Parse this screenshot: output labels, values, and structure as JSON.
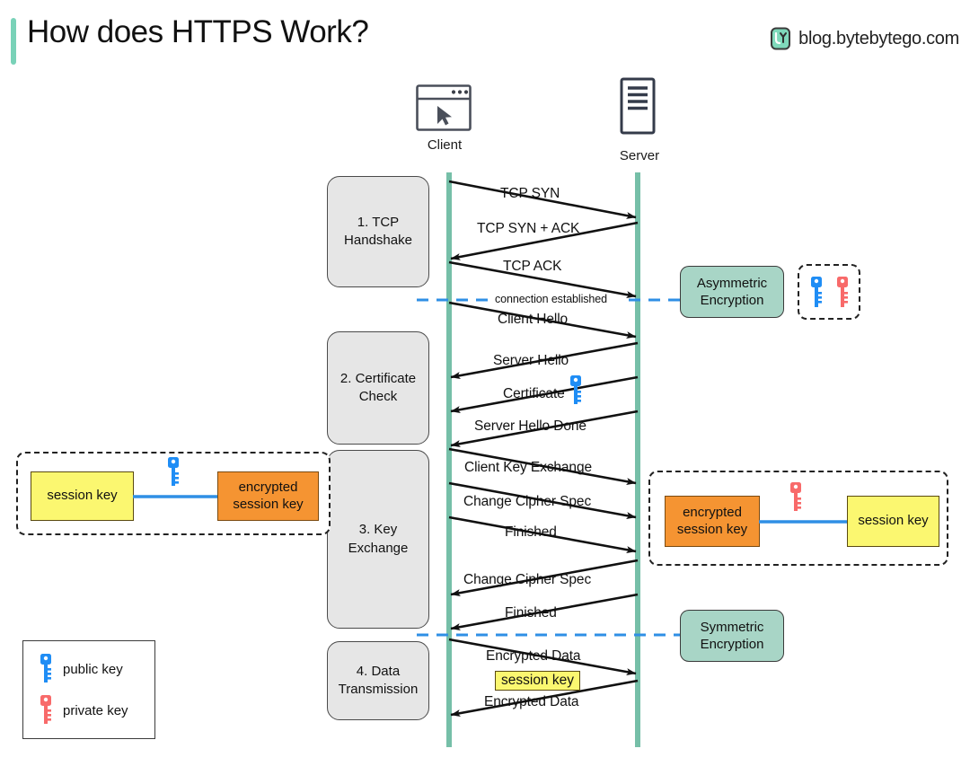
{
  "header": {
    "title": "How does HTTPS Work?",
    "brand_text": "blog.bytebytego.com",
    "accent_color": "#79d2b8",
    "logo_icon": "bytebytego-logo-icon"
  },
  "actors": {
    "client": {
      "label": "Client",
      "icon": "browser-window-icon"
    },
    "server": {
      "label": "Server",
      "icon": "server-rack-icon"
    },
    "lifeline_color": "#76bfa8"
  },
  "stages": [
    {
      "label": "1. TCP\nHandshake",
      "line1": "1. TCP",
      "line2": "Handshake"
    },
    {
      "label": "2. Certificate\nCheck",
      "line1": "2. Certificate",
      "line2": "Check"
    },
    {
      "label": "3. Key\nExchange",
      "line1": "3. Key",
      "line2": "Exchange"
    },
    {
      "label": "4. Data\nTransmission",
      "line1": "4. Data",
      "line2": "Transmission"
    }
  ],
  "messages": [
    {
      "label": "TCP SYN",
      "direction": "client-to-server"
    },
    {
      "label": "TCP SYN + ACK",
      "direction": "server-to-client"
    },
    {
      "label": "TCP ACK",
      "direction": "client-to-server"
    },
    {
      "label": "Client Hello",
      "direction": "client-to-server"
    },
    {
      "label": "Server Hello",
      "direction": "server-to-client"
    },
    {
      "label": "Certificate",
      "direction": "server-to-client",
      "icon": "public-key-icon"
    },
    {
      "label": "Server Hello Done",
      "direction": "server-to-client"
    },
    {
      "label": "Client Key Exchange",
      "direction": "client-to-server"
    },
    {
      "label": "Change Cipher Spec",
      "direction": "client-to-server"
    },
    {
      "label": "Finished",
      "direction": "client-to-server"
    },
    {
      "label": "Change Cipher Spec",
      "direction": "server-to-client"
    },
    {
      "label": "Finished",
      "direction": "server-to-client"
    },
    {
      "label": "Encrypted  Data",
      "direction": "client-to-server"
    },
    {
      "label": "Encrypted Data",
      "direction": "server-to-client"
    }
  ],
  "separators": [
    {
      "label": "connection established",
      "color": "#2f8fe5"
    },
    {
      "label": "",
      "color": "#2f8fe5"
    },
    {
      "label": "",
      "color": "#2f8fe5"
    }
  ],
  "session_key_badge": "session key",
  "encryption_labels": {
    "asymmetric_line1": "Asymmetric",
    "asymmetric_line2": "Encryption",
    "symmetric_line1": "Symmetric",
    "symmetric_line2": "Encryption",
    "box_color": "#a8d5c6"
  },
  "key_pair_group": {
    "public_key_icon": "public-key-icon",
    "private_key_icon": "private-key-icon"
  },
  "encrypt_flow": {
    "source_line1": "session key",
    "source_line2": "",
    "key_icon": "public-key-icon",
    "target_line1": "encrypted",
    "target_line2": "session key",
    "arrow_color": "#2f8fe5"
  },
  "decrypt_flow": {
    "source_line1": "encrypted",
    "source_line2": "session key",
    "key_icon": "private-key-icon",
    "target_line1": "session key",
    "target_line2": "",
    "arrow_color": "#2f8fe5"
  },
  "legend": {
    "items": [
      {
        "label": "public key",
        "icon": "public-key-icon",
        "color": "#1f8df5"
      },
      {
        "label": "private key",
        "icon": "private-key-icon",
        "color": "#f86a6a"
      }
    ]
  },
  "colors": {
    "key_blue": "#1f8df5",
    "key_red": "#f86a6a",
    "yellow": "#fbf770",
    "orange": "#f59432",
    "green_box": "#a8d5c6",
    "lifeline": "#76bfa8",
    "dashed_blue": "#2f8fe5"
  }
}
